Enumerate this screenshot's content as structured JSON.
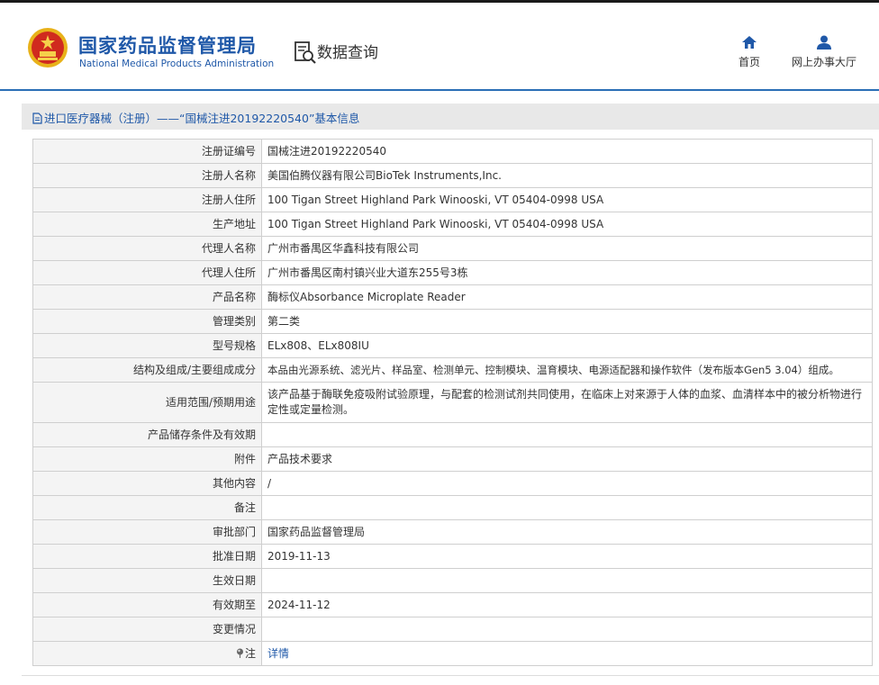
{
  "header": {
    "logo_cn": "国家药品监督管理局",
    "logo_en": "National Medical Products Administration",
    "query_title": "数据查询",
    "nav": [
      {
        "label": "首页",
        "icon": "home-icon"
      },
      {
        "label": "网上办事大厅",
        "icon": "user-icon"
      }
    ],
    "colors": {
      "brand": "#1f58a8",
      "line": "#2b6fb6"
    }
  },
  "breadcrumb": {
    "text": "进口医疗器械（注册）——“国械注进20192220540”基本信息"
  },
  "record": [
    {
      "label": "注册证编号",
      "value": "国械注进20192220540"
    },
    {
      "label": "注册人名称",
      "value": "美国伯腾仪器有限公司BioTek Instruments,Inc."
    },
    {
      "label": "注册人住所",
      "value": "100 Tigan Street Highland Park Winooski, VT 05404-0998 USA"
    },
    {
      "label": "生产地址",
      "value": "100 Tigan Street Highland Park Winooski, VT 05404-0998 USA"
    },
    {
      "label": "代理人名称",
      "value": "广州市番禺区华鑫科技有限公司"
    },
    {
      "label": "代理人住所",
      "value": "广州市番禺区南村镇兴业大道东255号3栋"
    },
    {
      "label": "产品名称",
      "value": "酶标仪Absorbance Microplate Reader"
    },
    {
      "label": "管理类别",
      "value": "第二类"
    },
    {
      "label": "型号规格",
      "value": "ELx808、ELx808IU"
    },
    {
      "label": "结构及组成/主要组成成分",
      "value": "本品由光源系统、滤光片、样品室、检测单元、控制模块、温育模块、电源适配器和操作软件（发布版本Gen5 3.04）组成。"
    },
    {
      "label": "适用范围/预期用途",
      "value": "该产品基于酶联免疫吸附试验原理，与配套的检测试剂共同使用，在临床上对来源于人体的血浆、血清样本中的被分析物进行定性或定量检测。"
    },
    {
      "label": "产品储存条件及有效期",
      "value": ""
    },
    {
      "label": "附件",
      "value": "产品技术要求"
    },
    {
      "label": "其他内容",
      "value": "/"
    },
    {
      "label": "备注",
      "value": ""
    },
    {
      "label": "审批部门",
      "value": "国家药品监督管理局"
    },
    {
      "label": "批准日期",
      "value": "2019-11-13"
    },
    {
      "label": "生效日期",
      "value": ""
    },
    {
      "label": "有效期至",
      "value": "2024-11-12"
    },
    {
      "label": "变更情况",
      "value": ""
    },
    {
      "label": "注",
      "value": "详情"
    }
  ]
}
